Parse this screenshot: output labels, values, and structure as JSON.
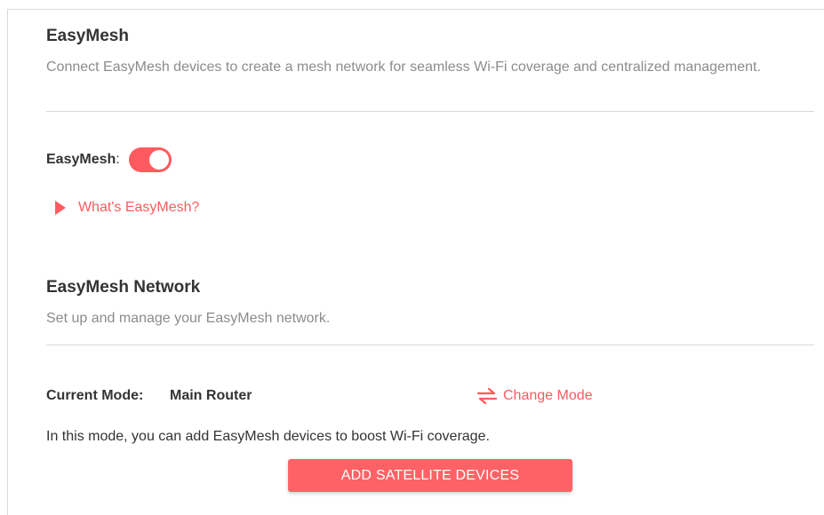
{
  "easymesh": {
    "title": "EasyMesh",
    "description": "Connect EasyMesh devices to create a mesh network for seamless Wi-Fi coverage and centralized management.",
    "toggle_label": "EasyMesh",
    "toggle_colon": ":",
    "toggle_on": true,
    "whats_link": "What's EasyMesh?"
  },
  "network": {
    "title": "EasyMesh Network",
    "description": "Set up and manage your EasyMesh network.",
    "current_mode_label": "Current Mode:",
    "current_mode_value": "Main Router",
    "change_mode_label": "Change Mode",
    "mode_description": "In this mode, you can add EasyMesh devices to boost Wi-Fi coverage.",
    "add_button_label": "ADD SATELLITE DEVICES"
  },
  "colors": {
    "accent": "#ff5a5f",
    "title": "#333333",
    "muted": "#8c8c8c",
    "divider": "#d9d9d9"
  },
  "icons": {
    "whats_link": "triangle-right-icon",
    "change_mode": "swap-arrows-icon"
  }
}
